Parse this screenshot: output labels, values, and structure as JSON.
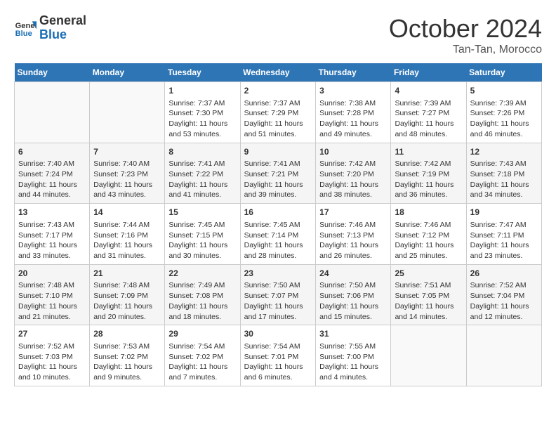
{
  "header": {
    "logo_line1": "General",
    "logo_line2": "Blue",
    "month": "October 2024",
    "location": "Tan-Tan, Morocco"
  },
  "weekdays": [
    "Sunday",
    "Monday",
    "Tuesday",
    "Wednesday",
    "Thursday",
    "Friday",
    "Saturday"
  ],
  "weeks": [
    [
      {
        "day": "",
        "sunrise": "",
        "sunset": "",
        "daylight": ""
      },
      {
        "day": "",
        "sunrise": "",
        "sunset": "",
        "daylight": ""
      },
      {
        "day": "1",
        "sunrise": "Sunrise: 7:37 AM",
        "sunset": "Sunset: 7:30 PM",
        "daylight": "Daylight: 11 hours and 53 minutes."
      },
      {
        "day": "2",
        "sunrise": "Sunrise: 7:37 AM",
        "sunset": "Sunset: 7:29 PM",
        "daylight": "Daylight: 11 hours and 51 minutes."
      },
      {
        "day": "3",
        "sunrise": "Sunrise: 7:38 AM",
        "sunset": "Sunset: 7:28 PM",
        "daylight": "Daylight: 11 hours and 49 minutes."
      },
      {
        "day": "4",
        "sunrise": "Sunrise: 7:39 AM",
        "sunset": "Sunset: 7:27 PM",
        "daylight": "Daylight: 11 hours and 48 minutes."
      },
      {
        "day": "5",
        "sunrise": "Sunrise: 7:39 AM",
        "sunset": "Sunset: 7:26 PM",
        "daylight": "Daylight: 11 hours and 46 minutes."
      }
    ],
    [
      {
        "day": "6",
        "sunrise": "Sunrise: 7:40 AM",
        "sunset": "Sunset: 7:24 PM",
        "daylight": "Daylight: 11 hours and 44 minutes."
      },
      {
        "day": "7",
        "sunrise": "Sunrise: 7:40 AM",
        "sunset": "Sunset: 7:23 PM",
        "daylight": "Daylight: 11 hours and 43 minutes."
      },
      {
        "day": "8",
        "sunrise": "Sunrise: 7:41 AM",
        "sunset": "Sunset: 7:22 PM",
        "daylight": "Daylight: 11 hours and 41 minutes."
      },
      {
        "day": "9",
        "sunrise": "Sunrise: 7:41 AM",
        "sunset": "Sunset: 7:21 PM",
        "daylight": "Daylight: 11 hours and 39 minutes."
      },
      {
        "day": "10",
        "sunrise": "Sunrise: 7:42 AM",
        "sunset": "Sunset: 7:20 PM",
        "daylight": "Daylight: 11 hours and 38 minutes."
      },
      {
        "day": "11",
        "sunrise": "Sunrise: 7:42 AM",
        "sunset": "Sunset: 7:19 PM",
        "daylight": "Daylight: 11 hours and 36 minutes."
      },
      {
        "day": "12",
        "sunrise": "Sunrise: 7:43 AM",
        "sunset": "Sunset: 7:18 PM",
        "daylight": "Daylight: 11 hours and 34 minutes."
      }
    ],
    [
      {
        "day": "13",
        "sunrise": "Sunrise: 7:43 AM",
        "sunset": "Sunset: 7:17 PM",
        "daylight": "Daylight: 11 hours and 33 minutes."
      },
      {
        "day": "14",
        "sunrise": "Sunrise: 7:44 AM",
        "sunset": "Sunset: 7:16 PM",
        "daylight": "Daylight: 11 hours and 31 minutes."
      },
      {
        "day": "15",
        "sunrise": "Sunrise: 7:45 AM",
        "sunset": "Sunset: 7:15 PM",
        "daylight": "Daylight: 11 hours and 30 minutes."
      },
      {
        "day": "16",
        "sunrise": "Sunrise: 7:45 AM",
        "sunset": "Sunset: 7:14 PM",
        "daylight": "Daylight: 11 hours and 28 minutes."
      },
      {
        "day": "17",
        "sunrise": "Sunrise: 7:46 AM",
        "sunset": "Sunset: 7:13 PM",
        "daylight": "Daylight: 11 hours and 26 minutes."
      },
      {
        "day": "18",
        "sunrise": "Sunrise: 7:46 AM",
        "sunset": "Sunset: 7:12 PM",
        "daylight": "Daylight: 11 hours and 25 minutes."
      },
      {
        "day": "19",
        "sunrise": "Sunrise: 7:47 AM",
        "sunset": "Sunset: 7:11 PM",
        "daylight": "Daylight: 11 hours and 23 minutes."
      }
    ],
    [
      {
        "day": "20",
        "sunrise": "Sunrise: 7:48 AM",
        "sunset": "Sunset: 7:10 PM",
        "daylight": "Daylight: 11 hours and 21 minutes."
      },
      {
        "day": "21",
        "sunrise": "Sunrise: 7:48 AM",
        "sunset": "Sunset: 7:09 PM",
        "daylight": "Daylight: 11 hours and 20 minutes."
      },
      {
        "day": "22",
        "sunrise": "Sunrise: 7:49 AM",
        "sunset": "Sunset: 7:08 PM",
        "daylight": "Daylight: 11 hours and 18 minutes."
      },
      {
        "day": "23",
        "sunrise": "Sunrise: 7:50 AM",
        "sunset": "Sunset: 7:07 PM",
        "daylight": "Daylight: 11 hours and 17 minutes."
      },
      {
        "day": "24",
        "sunrise": "Sunrise: 7:50 AM",
        "sunset": "Sunset: 7:06 PM",
        "daylight": "Daylight: 11 hours and 15 minutes."
      },
      {
        "day": "25",
        "sunrise": "Sunrise: 7:51 AM",
        "sunset": "Sunset: 7:05 PM",
        "daylight": "Daylight: 11 hours and 14 minutes."
      },
      {
        "day": "26",
        "sunrise": "Sunrise: 7:52 AM",
        "sunset": "Sunset: 7:04 PM",
        "daylight": "Daylight: 11 hours and 12 minutes."
      }
    ],
    [
      {
        "day": "27",
        "sunrise": "Sunrise: 7:52 AM",
        "sunset": "Sunset: 7:03 PM",
        "daylight": "Daylight: 11 hours and 10 minutes."
      },
      {
        "day": "28",
        "sunrise": "Sunrise: 7:53 AM",
        "sunset": "Sunset: 7:02 PM",
        "daylight": "Daylight: 11 hours and 9 minutes."
      },
      {
        "day": "29",
        "sunrise": "Sunrise: 7:54 AM",
        "sunset": "Sunset: 7:02 PM",
        "daylight": "Daylight: 11 hours and 7 minutes."
      },
      {
        "day": "30",
        "sunrise": "Sunrise: 7:54 AM",
        "sunset": "Sunset: 7:01 PM",
        "daylight": "Daylight: 11 hours and 6 minutes."
      },
      {
        "day": "31",
        "sunrise": "Sunrise: 7:55 AM",
        "sunset": "Sunset: 7:00 PM",
        "daylight": "Daylight: 11 hours and 4 minutes."
      },
      {
        "day": "",
        "sunrise": "",
        "sunset": "",
        "daylight": ""
      },
      {
        "day": "",
        "sunrise": "",
        "sunset": "",
        "daylight": ""
      }
    ]
  ]
}
